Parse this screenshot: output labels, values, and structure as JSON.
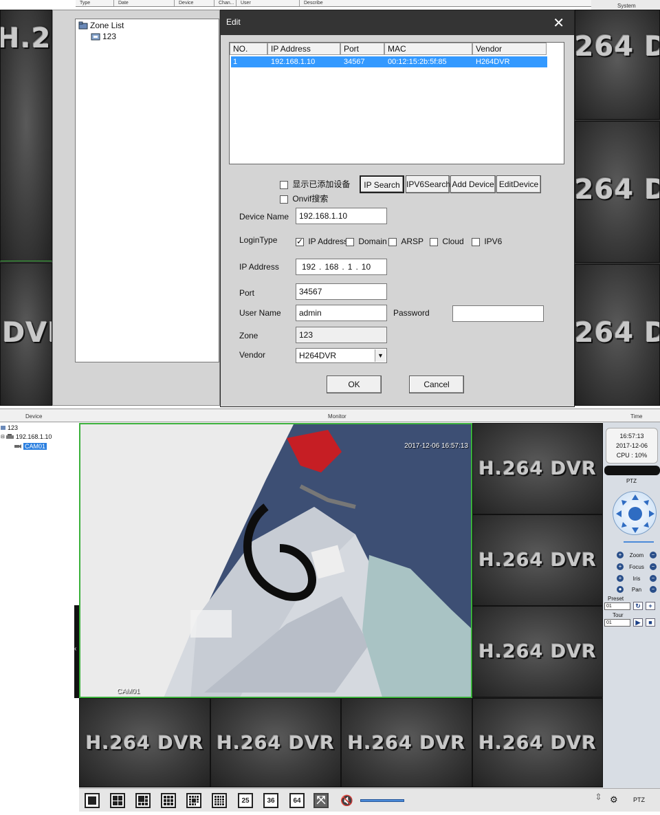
{
  "top_strip": {
    "columns": [
      "Type",
      "Date",
      "Device",
      "Chan...",
      "User",
      "Describe"
    ],
    "corner_label": "System"
  },
  "zone_tree": {
    "root": "Zone List",
    "child": "123"
  },
  "edit_dialog": {
    "title": "Edit",
    "table": {
      "headers": [
        "NO.",
        "IP Address",
        "Port",
        "MAC",
        "Vendor"
      ],
      "rows": [
        [
          "1",
          "192.168.1.10",
          "34567",
          "00:12:15:2b:5f:85",
          "H264DVR"
        ]
      ]
    },
    "show_added_label": "显示已添加设备",
    "onvif_label": "Onvif搜索",
    "buttons": {
      "ip_search": "IP Search",
      "ipv6_search": "IPV6Search",
      "add_device": "Add Device",
      "edit_device": "EditDevice",
      "ok": "OK",
      "cancel": "Cancel"
    },
    "fields": {
      "device_name_label": "Device Name",
      "device_name": "192.168.1.10",
      "login_type_label": "LoginType",
      "login_options": [
        "IP Address",
        "Domain",
        "ARSP",
        "Cloud",
        "IPV6"
      ],
      "ip_label": "IP Address",
      "ip_parts": [
        "192",
        "168",
        "1",
        "10"
      ],
      "port_label": "Port",
      "port": "34567",
      "user_label": "User Name",
      "user": "admin",
      "password_label": "Password",
      "password": "",
      "zone_label": "Zone",
      "zone": "123",
      "vendor_label": "Vendor",
      "vendor": "H264DVR"
    }
  },
  "dvr_logo": "H.264 DVR",
  "section_bar": {
    "device": "Device",
    "monitor": "Monitor",
    "time": "Time"
  },
  "device_tree": {
    "root": "123",
    "device": "192.168.1.10",
    "camera": "CAM01"
  },
  "live_view": {
    "timestamp": "2017-12-06 16:57:13",
    "channel": "CAM01"
  },
  "toolbar": {
    "layouts": [
      "25",
      "36",
      "64"
    ]
  },
  "right_panel": {
    "time": "16:57:13",
    "date": "2017-12-06",
    "cpu": "CPU : 10%",
    "ptz_title": "PTZ",
    "controls": [
      "Zoom",
      "Focus",
      "Iris",
      "Pan"
    ],
    "preset_label": "Preset",
    "preset_value": "01",
    "tour_label": "Tour",
    "tour_value": "01",
    "bottom_label": "PTZ"
  }
}
